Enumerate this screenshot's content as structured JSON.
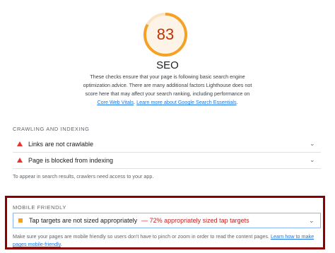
{
  "score": {
    "value": "83",
    "fraction": 0.83,
    "color": "#f4a125",
    "track_color": "#fbe4c4",
    "title": "SEO"
  },
  "description": {
    "text": "These checks ensure that your page is following basic search engine optimization advice. There are many additional factors Lighthouse does not score here that may affect your search ranking, including performance on ",
    "link1": "Core Web Vitals",
    "between": ". ",
    "link2": "Learn more about Google Search Essentials",
    "end": "."
  },
  "crawling": {
    "title": "CRAWLING AND INDEXING",
    "items": [
      {
        "label": "Links are not crawlable",
        "icon": "warning-triangle-icon"
      },
      {
        "label": "Page is blocked from indexing",
        "icon": "warning-triangle-icon"
      }
    ],
    "note": "To appear in search results, crawlers need access to your app."
  },
  "mobile": {
    "title": "MOBILE FRIENDLY",
    "audit_label": "Tap targets are not sized appropriately",
    "audit_detail": "— 72% appropriately sized tap targets",
    "note": "Make sure your pages are mobile friendly so users don't have to pinch or zoom in order to read the content pages. ",
    "link": "Learn how to make pages mobile-friendly",
    "end": "."
  },
  "colors": {
    "error": "#e8332c",
    "average": "#f4a125",
    "highlight_border": "#8b0000",
    "link": "#1a73e8"
  }
}
